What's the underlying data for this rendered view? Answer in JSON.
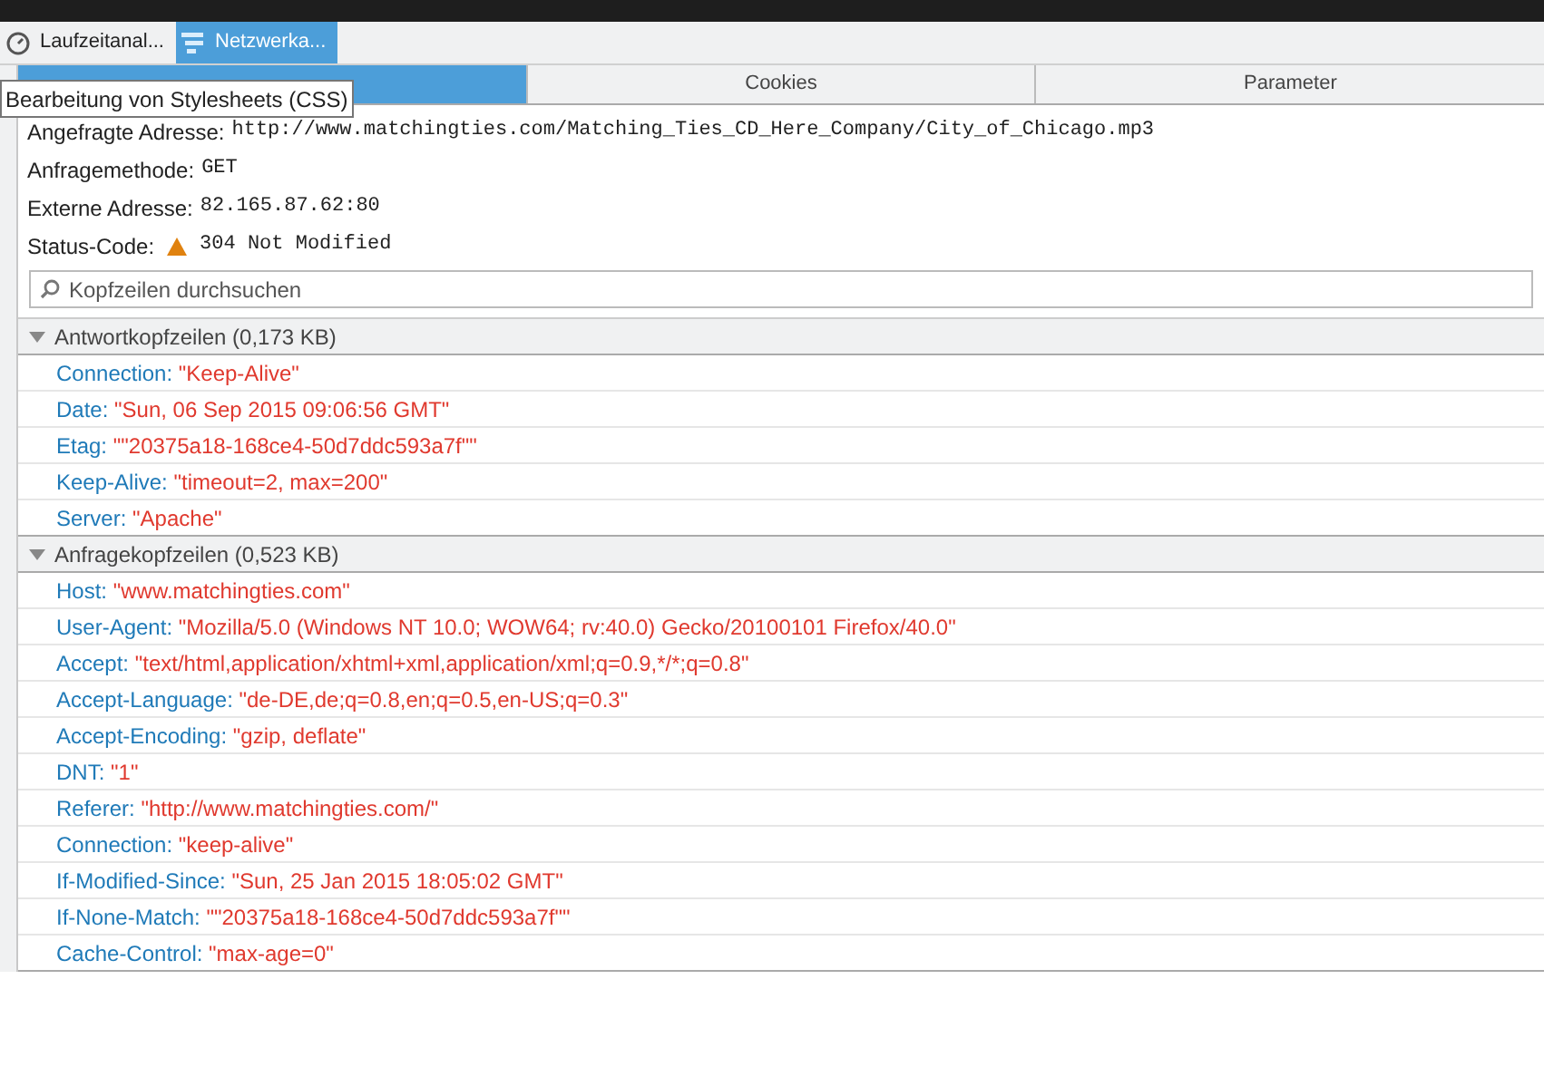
{
  "toolbox_tabs": [
    {
      "label": "Laufzeitanal...",
      "kind": "clock",
      "selected": false
    },
    {
      "label": "Netzwerka...",
      "kind": "network",
      "selected": true
    }
  ],
  "detail_tabs": [
    {
      "selected": true
    },
    {
      "label": "Cookies",
      "selected": false
    },
    {
      "label": "Parameter",
      "selected": false
    }
  ],
  "tooltip": "Bearbeitung von Stylesheets (CSS)",
  "summary": [
    {
      "label": "Angefragte Adresse:",
      "value": "http://www.matchingties.com/Matching_Ties_CD_Here_Company/City_of_Chicago.mp3",
      "warning": false
    },
    {
      "label": "Anfragemethode:",
      "value": "GET",
      "warning": false
    },
    {
      "label": "Externe Adresse:",
      "value": "82.165.87.62:80",
      "warning": false
    },
    {
      "label": "Status-Code:",
      "value": "304 Not Modified",
      "warning": true
    }
  ],
  "search": {
    "placeholder": "Kopfzeilen durchsuchen"
  },
  "sections": [
    {
      "title": "Antwortkopfzeilen (0,173 KB)",
      "expanded": true,
      "headers": [
        {
          "name": "Connection:",
          "value": "\"Keep-Alive\""
        },
        {
          "name": "Date:",
          "value": "\"Sun, 06 Sep 2015 09:06:56 GMT\""
        },
        {
          "name": "Etag:",
          "value": "\"\"20375a18-168ce4-50d7ddc593a7f\"\""
        },
        {
          "name": "Keep-Alive:",
          "value": "\"timeout=2, max=200\""
        },
        {
          "name": "Server:",
          "value": "\"Apache\""
        }
      ]
    },
    {
      "title": "Anfragekopfzeilen (0,523 KB)",
      "expanded": true,
      "headers": [
        {
          "name": "Host:",
          "value": "\"www.matchingties.com\""
        },
        {
          "name": "User-Agent:",
          "value": "\"Mozilla/5.0 (Windows NT 10.0; WOW64; rv:40.0) Gecko/20100101 Firefox/40.0\""
        },
        {
          "name": "Accept:",
          "value": "\"text/html,application/xhtml+xml,application/xml;q=0.9,*/*;q=0.8\""
        },
        {
          "name": "Accept-Language:",
          "value": "\"de-DE,de;q=0.8,en;q=0.5,en-US;q=0.3\""
        },
        {
          "name": "Accept-Encoding:",
          "value": "\"gzip, deflate\""
        },
        {
          "name": "DNT:",
          "value": "\"1\""
        },
        {
          "name": "Referer:",
          "value": "\"http://www.matchingties.com/\""
        },
        {
          "name": "Connection:",
          "value": "\"keep-alive\""
        },
        {
          "name": "If-Modified-Since:",
          "value": "\"Sun, 25 Jan 2015 18:05:02 GMT\""
        },
        {
          "name": "If-None-Match:",
          "value": "\"\"20375a18-168ce4-50d7ddc593a7f\"\""
        },
        {
          "name": "Cache-Control:",
          "value": "\"max-age=0\""
        }
      ]
    }
  ]
}
